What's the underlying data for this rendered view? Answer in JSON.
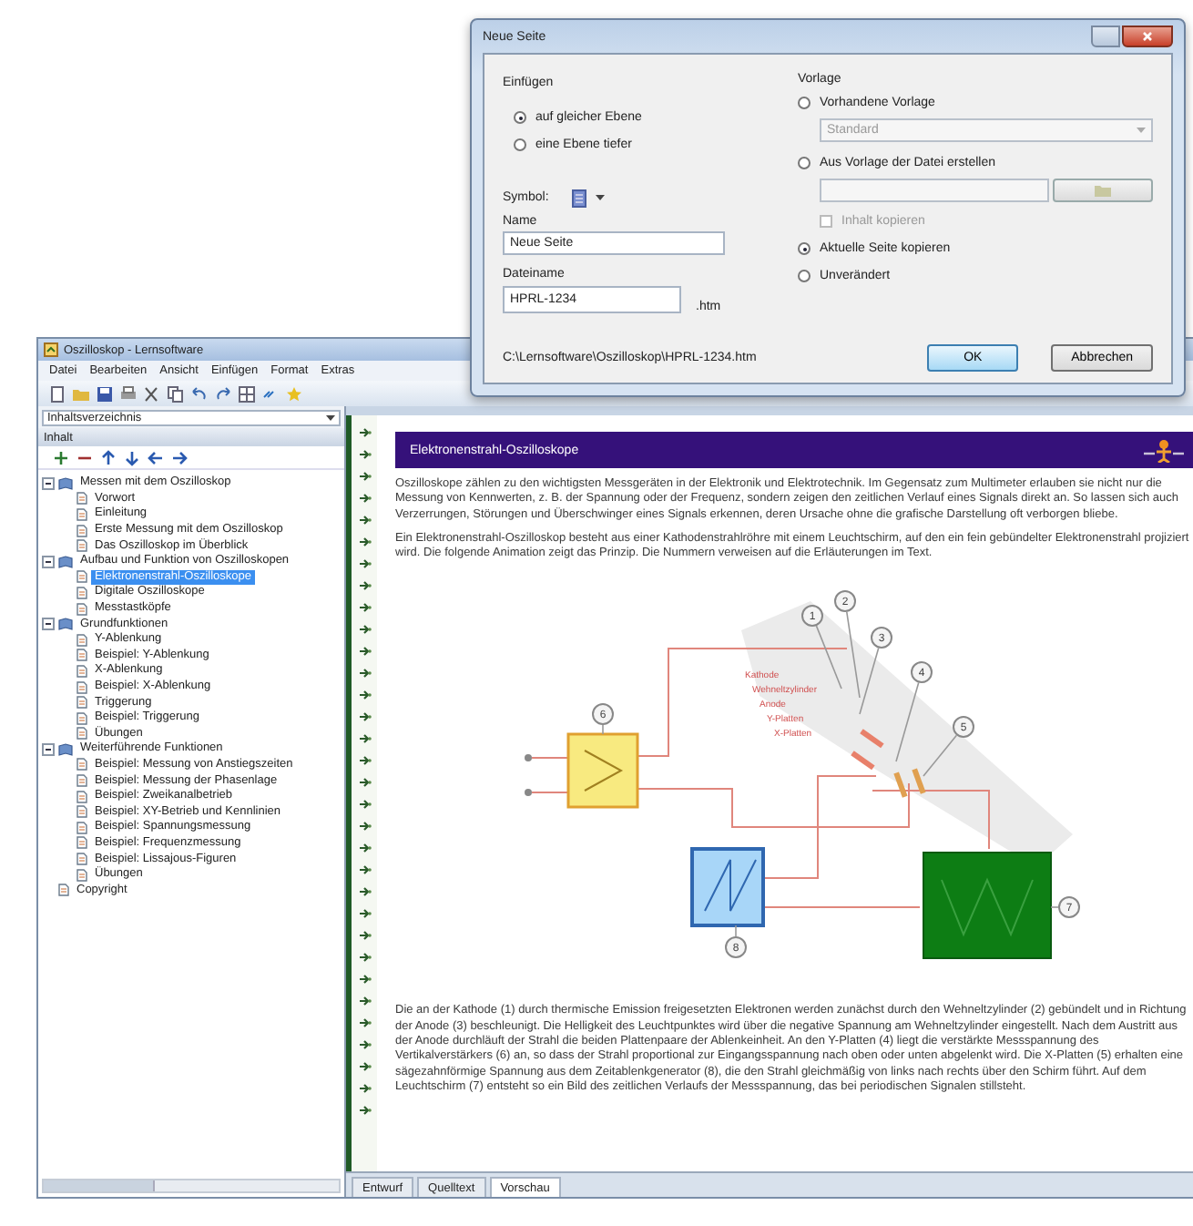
{
  "dialog": {
    "title": "Neue Seite",
    "insert": {
      "label": "Einfügen",
      "options": [
        {
          "label": "auf gleicher Ebene",
          "selected": true
        },
        {
          "label": "eine Ebene tiefer",
          "selected": false
        }
      ]
    },
    "symbol": {
      "label": "Symbol:"
    },
    "name": {
      "label": "Name",
      "value": "Neue Seite"
    },
    "filename": {
      "label": "Dateiname",
      "value": "HPRL-1234",
      "suffix": ".htm"
    },
    "path": "C:\\Lernsoftware\\Oszilloskop\\HPRL-1234.htm",
    "template": {
      "label": "Vorlage",
      "items": [
        {
          "kind": "radio",
          "label": "Vorhandene Vorlage",
          "selected": false
        },
        {
          "kind": "select",
          "value": "Standard",
          "disabled": true
        },
        {
          "kind": "radio",
          "label": "Aus Vorlage der Datei erstellen",
          "selected": false
        },
        {
          "kind": "file",
          "disabled": true
        },
        {
          "kind": "checkbox",
          "label": "Inhalt kopieren",
          "checked": false,
          "disabled": true
        },
        {
          "kind": "radio",
          "label": "Aktuelle Seite kopieren",
          "selected": true
        },
        {
          "kind": "radio",
          "label": "Unverändert",
          "selected": false
        }
      ]
    },
    "buttons": [
      {
        "label": "OK",
        "default": true
      },
      {
        "label": "Abbrechen",
        "default": false
      }
    ]
  },
  "window": {
    "title": "Oszilloskop - Lernsoftware",
    "menu": [
      "Datei",
      "Bearbeiten",
      "Ansicht",
      "Einfügen",
      "Format",
      "Extras"
    ],
    "left_pane": {
      "selector": "Inhaltsverzeichnis",
      "title": "Inhalt",
      "tree": [
        {
          "label": "Messen mit dem Oszilloskop",
          "expanded": true,
          "selected": false,
          "children": [
            {
              "label": "Vorwort",
              "selected": false
            },
            {
              "label": "Einleitung",
              "selected": false
            },
            {
              "label": "Erste Messung mit dem Oszilloskop",
              "selected": false
            },
            {
              "label": "Das Oszilloskop im Überblick",
              "selected": false
            }
          ]
        },
        {
          "label": "Aufbau und Funktion von Oszilloskopen",
          "expanded": true,
          "selected": false,
          "children": [
            {
              "label": "Elektronenstrahl-Oszilloskope",
              "selected": true
            },
            {
              "label": "Digitale Oszilloskope",
              "selected": false
            },
            {
              "label": "Messtastköpfe",
              "selected": false
            }
          ]
        },
        {
          "label": "Grundfunktionen",
          "expanded": true,
          "selected": false,
          "children": [
            {
              "label": "Y-Ablenkung",
              "selected": false
            },
            {
              "label": "Beispiel: Y-Ablenkung",
              "selected": false
            },
            {
              "label": "X-Ablenkung",
              "selected": false
            },
            {
              "label": "Beispiel: X-Ablenkung",
              "selected": false
            },
            {
              "label": "Triggerung",
              "selected": false
            },
            {
              "label": "Beispiel: Triggerung",
              "selected": false
            },
            {
              "label": "Übungen",
              "selected": false
            }
          ]
        },
        {
          "label": "Weiterführende Funktionen",
          "expanded": true,
          "selected": false,
          "children": [
            {
              "label": "Beispiel: Messung von Anstiegszeiten",
              "selected": false
            },
            {
              "label": "Beispiel: Messung der Phasenlage",
              "selected": false
            },
            {
              "label": "Beispiel: Zweikanalbetrieb",
              "selected": false
            },
            {
              "label": "Beispiel: XY-Betrieb und Kennlinien",
              "selected": false
            },
            {
              "label": "Beispiel: Spannungsmessung",
              "selected": false
            },
            {
              "label": "Beispiel: Frequenzmessung",
              "selected": false
            },
            {
              "label": "Beispiel: Lissajous-Figuren",
              "selected": false
            },
            {
              "label": "Übungen",
              "selected": false
            }
          ]
        },
        {
          "label": "Copyright",
          "selected": false
        }
      ]
    },
    "content": {
      "heading": "Elektronenstrahl-Oszilloskope",
      "intro": [
        "Oszilloskope zählen zu den wichtigsten Messgeräten in der Elektronik und Elektrotechnik. Im Gegensatz zum Multimeter erlauben sie nicht nur die Messung von Kennwerten, z. B. der Spannung oder der Frequenz, sondern zeigen den zeitlichen Verlauf eines Signals direkt an. So lassen sich auch Verzerrungen, Störungen und Überschwinger eines Signals erkennen, deren Ursache ohne die grafische Darstellung oft verborgen bliebe.",
        "Ein Elektronenstrahl-Oszilloskop besteht aus einer Kathodenstrahlröhre mit einem Leuchtschirm, auf den ein fein gebündelter Elektronenstrahl projiziert wird. Die folgende Animation zeigt das Prinzip. Die Nummern verweisen auf die Erläuterungen im Text."
      ],
      "diagram": {
        "labels": [
          "Kathode",
          "Wehneltzylinder",
          "Anode",
          "Y-Platten",
          "X-Platten"
        ],
        "callouts": [
          "1",
          "2",
          "3",
          "4",
          "5",
          "6",
          "7",
          "8"
        ]
      },
      "body": "Die an der Kathode (1) durch thermische Emission freigesetzten Elektronen werden zunächst durch den Wehneltzylinder (2) gebündelt und in Richtung der Anode (3) beschleunigt. Die Helligkeit des Leuchtpunktes wird über die negative Spannung am Wehneltzylinder eingestellt. Nach dem Austritt aus der Anode durchläuft der Strahl die beiden Plattenpaare der Ablenkeinheit. An den Y-Platten (4) liegt die verstärkte Messspannung des Vertikalverstärkers (6) an, so dass der Strahl proportional zur Eingangsspannung nach oben oder unten abgelenkt wird. Die X-Platten (5) erhalten eine sägezahnförmige Spannung aus dem Zeitablenkgenerator (8), die den Strahl gleichmäßig von links nach rechts über den Schirm führt. Auf dem Leuchtschirm (7) entsteht so ein Bild des zeitlichen Verlaufs der Messspannung, das bei periodischen Signalen stillsteht."
    },
    "editor_tabs": [
      {
        "label": "Entwurf",
        "selected": false
      },
      {
        "label": "Quelltext",
        "selected": false
      },
      {
        "label": "Vorschau",
        "selected": true
      }
    ]
  }
}
